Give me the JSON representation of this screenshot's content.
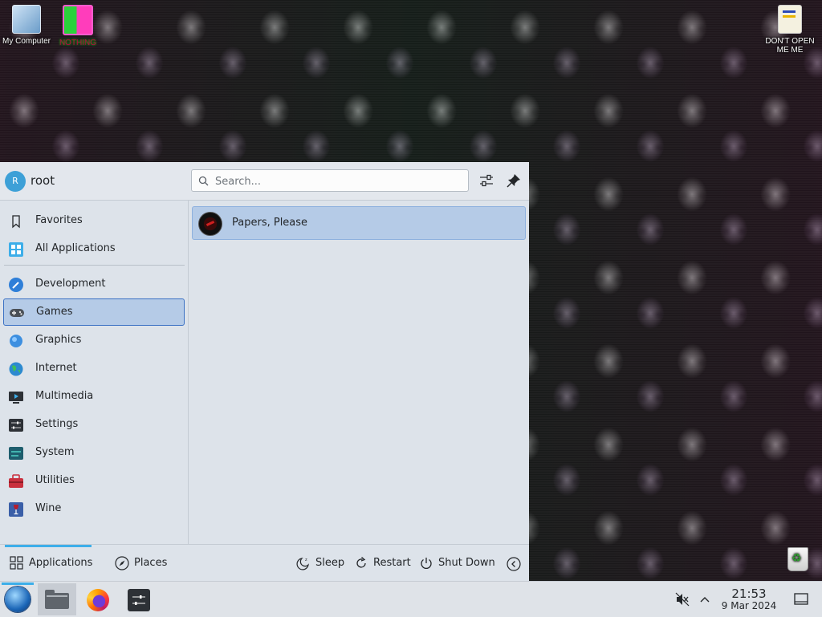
{
  "desktop": {
    "icons": [
      {
        "label": "My Computer"
      },
      {
        "label": "NOTHING"
      },
      {
        "label": "DON'T OPEN ME ME"
      },
      {
        "label": ""
      }
    ]
  },
  "launcher": {
    "user": {
      "initial": "R",
      "name": "root"
    },
    "search": {
      "placeholder": "Search..."
    },
    "categories": [
      {
        "label": "Favorites",
        "icon": "bookmark-icon"
      },
      {
        "label": "All Applications",
        "icon": "grid-icon"
      },
      {
        "label": "Development",
        "icon": "development-icon"
      },
      {
        "label": "Games",
        "icon": "gamepad-icon",
        "selected": true
      },
      {
        "label": "Graphics",
        "icon": "graphics-icon"
      },
      {
        "label": "Internet",
        "icon": "globe-icon"
      },
      {
        "label": "Multimedia",
        "icon": "multimedia-icon"
      },
      {
        "label": "Settings",
        "icon": "settings-icon"
      },
      {
        "label": "System",
        "icon": "system-icon"
      },
      {
        "label": "Utilities",
        "icon": "toolbox-icon"
      },
      {
        "label": "Wine",
        "icon": "wine-icon"
      }
    ],
    "apps": [
      {
        "label": "Papers, Please",
        "icon": "papers-please-icon"
      }
    ],
    "footer": {
      "applications_label": "Applications",
      "places_label": "Places",
      "sleep_label": "Sleep",
      "restart_label": "Restart",
      "shutdown_label": "Shut Down"
    }
  },
  "taskbar": {
    "clock_time": "21:53",
    "clock_date": "9 Mar 2024"
  },
  "colors": {
    "accent": "#3daee9",
    "selection_bg": "#b5cbe7",
    "selection_border": "#3c72c4",
    "panel_bg": "#dde3ea"
  }
}
